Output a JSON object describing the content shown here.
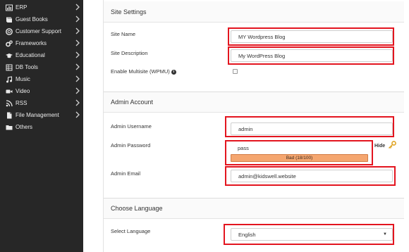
{
  "sidebar": {
    "items": [
      {
        "label": "ERP",
        "icon": "grid-icon"
      },
      {
        "label": "Guest Books",
        "icon": "book-icon"
      },
      {
        "label": "Customer Support",
        "icon": "lifebuoy-icon"
      },
      {
        "label": "Frameworks",
        "icon": "cogs-icon"
      },
      {
        "label": "Educational",
        "icon": "graduation-cap-icon"
      },
      {
        "label": "DB Tools",
        "icon": "database-icon"
      },
      {
        "label": "Music",
        "icon": "music-icon"
      },
      {
        "label": "Video",
        "icon": "video-camera-icon"
      },
      {
        "label": "RSS",
        "icon": "rss-icon"
      },
      {
        "label": "File Management",
        "icon": "file-icon"
      },
      {
        "label": "Others",
        "icon": "folder-icon"
      }
    ]
  },
  "site_settings": {
    "title": "Site Settings",
    "site_name_label": "Site Name",
    "site_name_value": "MY Wordpress Blog",
    "site_description_label": "Site Description",
    "site_description_value": "My WordPress Blog",
    "multisite_label": "Enable Multisite (WPMU)",
    "multisite_checked": false
  },
  "admin_account": {
    "title": "Admin Account",
    "username_label": "Admin Username",
    "username_value": "admin",
    "password_label": "Admin Password",
    "password_value": "pass",
    "strength_text": "Bad (18/100)",
    "hide_label": "Hide",
    "email_label": "Admin Email",
    "email_value": "admin@kidswell.website"
  },
  "language": {
    "title": "Choose Language",
    "select_label": "Select Language",
    "selected": "English"
  },
  "colors": {
    "sidebar_bg": "#272727",
    "highlight": "#e3151f",
    "strength_bad": "#f5a66f",
    "key_icon": "#e0a526"
  }
}
